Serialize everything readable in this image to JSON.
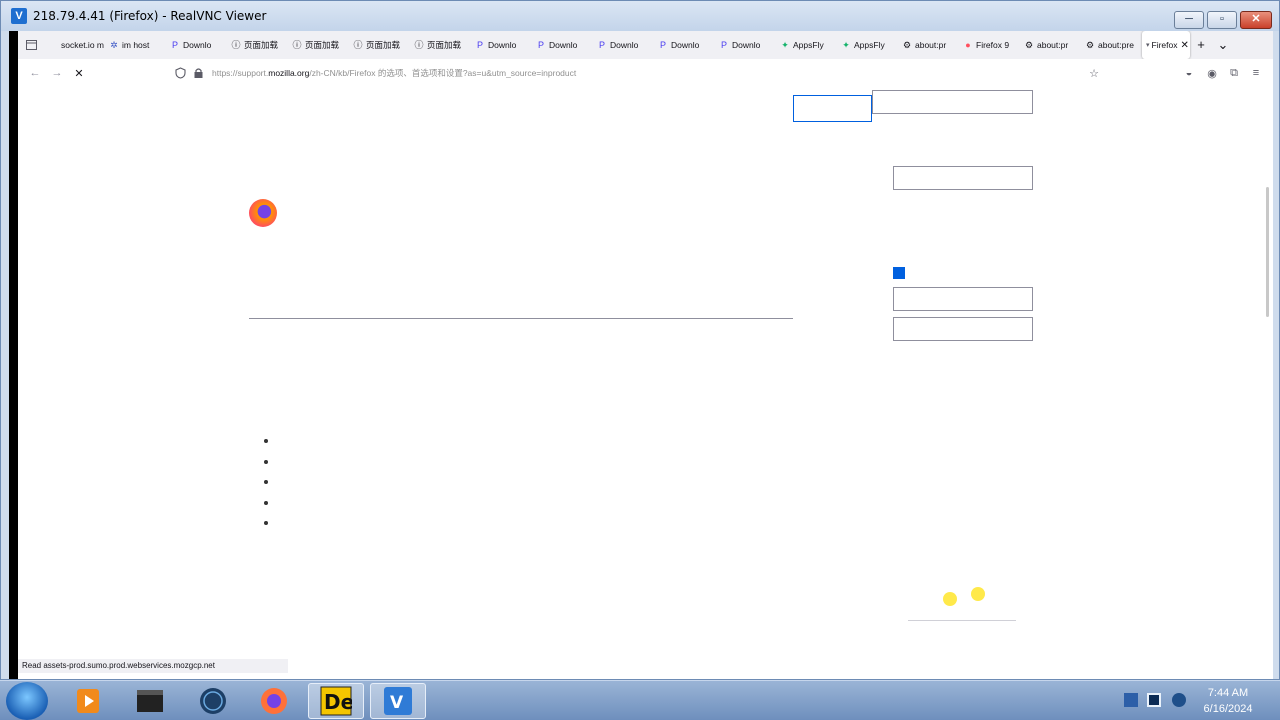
{
  "vnc": {
    "app_icon_text": "V",
    "title": "218.79.4.41 (Firefox) - RealVNC Viewer",
    "min_label": "─",
    "max_label": "▫",
    "close_label": "✕"
  },
  "firefox": {
    "tabs": [
      {
        "label": "socket.io m",
        "icon": "page-icon",
        "icon_text": " "
      },
      {
        "label": "im host",
        "icon": "gear-cluster-icon",
        "icon_text": "✲"
      },
      {
        "label": "Downlo",
        "icon": "p-logo-icon",
        "icon_text": "P"
      },
      {
        "label": "页面加载",
        "icon": "info-icon",
        "icon_text": "ⓘ"
      },
      {
        "label": "页面加载",
        "icon": "info-icon",
        "icon_text": "ⓘ"
      },
      {
        "label": "页面加载",
        "icon": "info-icon",
        "icon_text": "ⓘ"
      },
      {
        "label": "页面加载",
        "icon": "info-icon",
        "icon_text": "ⓘ"
      },
      {
        "label": "Downlo",
        "icon": "p-logo-icon",
        "icon_text": "P"
      },
      {
        "label": "Downlo",
        "icon": "p-logo-icon",
        "icon_text": "P"
      },
      {
        "label": "Downlo",
        "icon": "p-logo-icon",
        "icon_text": "P"
      },
      {
        "label": "Downlo",
        "icon": "p-logo-icon",
        "icon_text": "P"
      },
      {
        "label": "Downlo",
        "icon": "p-logo-icon",
        "icon_text": "P"
      },
      {
        "label": "AppsFly",
        "icon": "appsflyer-icon",
        "icon_text": "✦"
      },
      {
        "label": "AppsFly",
        "icon": "appsflyer-icon",
        "icon_text": "✦"
      },
      {
        "label": "about:pr",
        "icon": "gear-icon",
        "icon_text": "⚙"
      },
      {
        "label": "Firefox 9",
        "icon": "firefox-icon",
        "icon_text": "●"
      },
      {
        "label": "about:pr",
        "icon": "gear-icon",
        "icon_text": "⚙"
      },
      {
        "label": "about:pre",
        "icon": "gear-icon",
        "icon_text": "⚙"
      }
    ],
    "active_tab_label": "Firefox",
    "new_tab_label": "+",
    "tab_overflow_label": "⌄",
    "url_prefix": "https://support.",
    "url_domain": "mozilla.org",
    "url_rest": "/zh-CN/kb/Firefox 的选项、首选项和设置?as=u&utm_source=inproduct",
    "status_text": "Read assets-prod.sumo.prod.webservices.mozgcp.net"
  },
  "taskbar": {
    "time": "7:44 AM",
    "date": "6/16/2024"
  },
  "colors": {
    "accent_blue": "#0060df",
    "vnc_title_bg": "#cfdced",
    "taskbar_bg": "#6e8fbd"
  }
}
